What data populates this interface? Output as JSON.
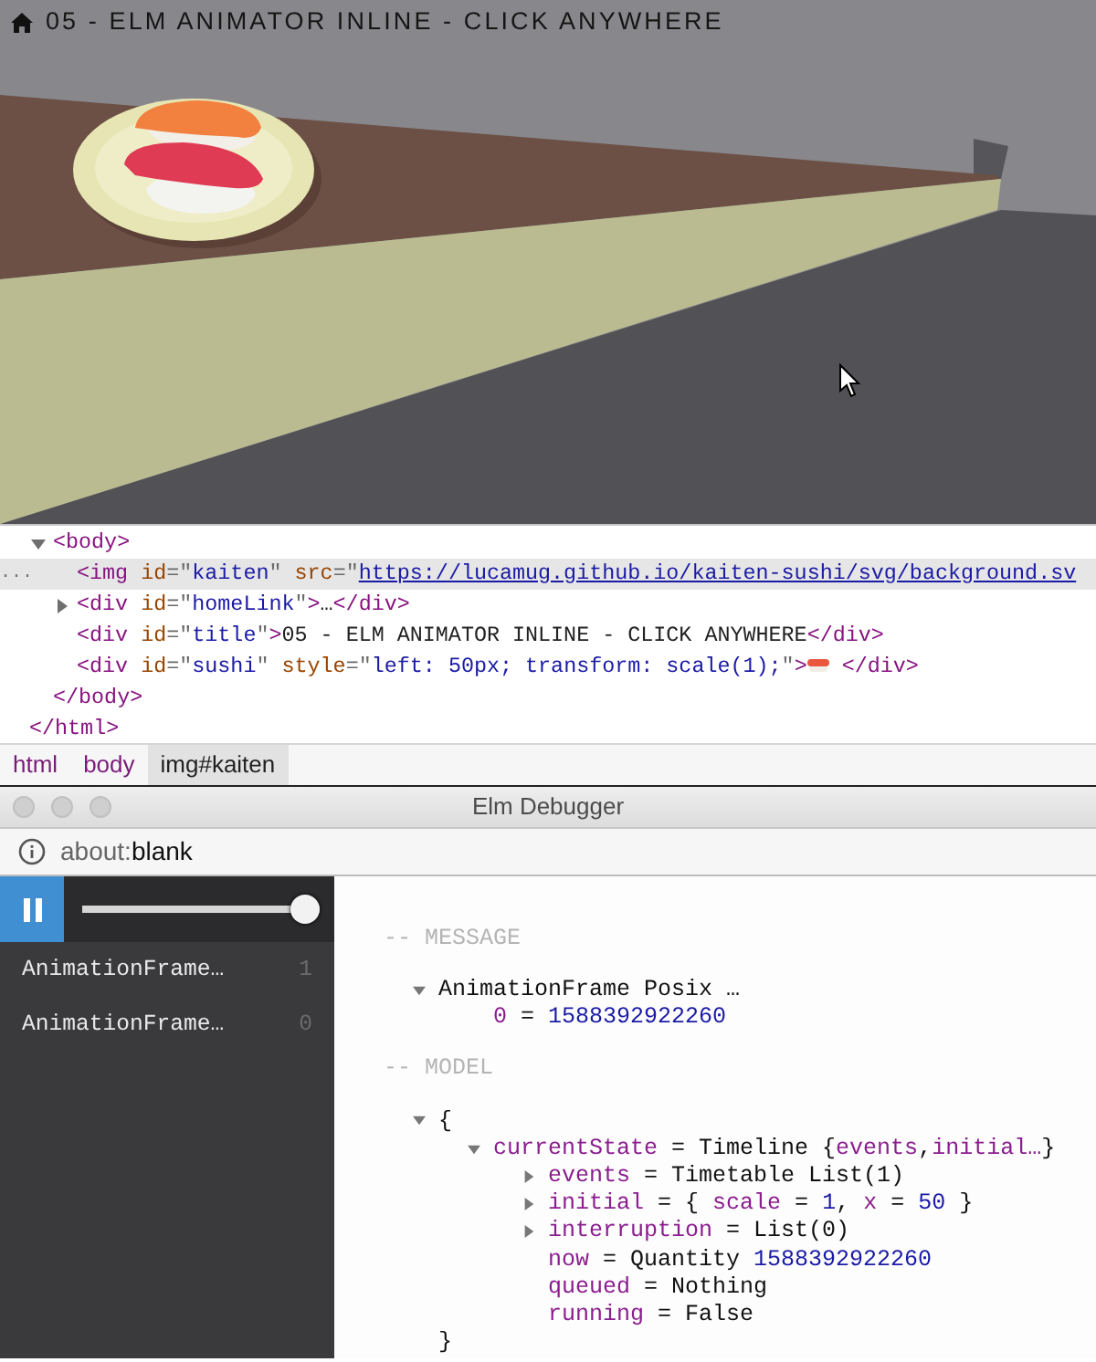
{
  "page_title": {
    "text": "05 - ELM ANIMATOR INLINE - CLICK ANYWHERE"
  },
  "elements_tree": {
    "children": [
      {
        "tokens": [
          {
            "kind": "tag",
            "text": "<body>"
          }
        ],
        "selected": false,
        "expanded": true,
        "close": [
          {
            "kind": "tag",
            "text": "</body>"
          }
        ],
        "children": [
          {
            "gutter": "...",
            "selected": true,
            "tokens": [
              {
                "kind": "tag",
                "text": "<img"
              },
              {
                "kind": "attr",
                "text": " id"
              },
              {
                "kind": "punct",
                "text": "=\""
              },
              {
                "kind": "value",
                "text": "kaiten"
              },
              {
                "kind": "punct",
                "text": "\""
              },
              {
                "kind": "attr",
                "text": " src"
              },
              {
                "kind": "punct",
                "text": "=\""
              },
              {
                "kind": "link",
                "text": "https://lucamug.github.io/kaiten-sushi/svg/background.sv"
              }
            ]
          },
          {
            "selected": false,
            "expanded": false,
            "tokens": [
              {
                "kind": "tag",
                "text": "<div"
              },
              {
                "kind": "attr",
                "text": " id"
              },
              {
                "kind": "punct",
                "text": "=\""
              },
              {
                "kind": "value",
                "text": "homeLink"
              },
              {
                "kind": "punct",
                "text": "\""
              },
              {
                "kind": "tag",
                "text": ">"
              },
              {
                "kind": "text",
                "text": "…"
              },
              {
                "kind": "tag",
                "text": "</div>"
              }
            ]
          },
          {
            "selected": false,
            "tokens": [
              {
                "kind": "tag",
                "text": "<div"
              },
              {
                "kind": "attr",
                "text": " id"
              },
              {
                "kind": "punct",
                "text": "=\""
              },
              {
                "kind": "value",
                "text": "title"
              },
              {
                "kind": "punct",
                "text": "\""
              },
              {
                "kind": "tag",
                "text": ">"
              },
              {
                "kind": "text",
                "text": "05 - ELM ANIMATOR INLINE - CLICK ANYWHERE"
              },
              {
                "kind": "tag",
                "text": "</div>"
              }
            ]
          },
          {
            "selected": false,
            "tokens": [
              {
                "kind": "tag",
                "text": "<div"
              },
              {
                "kind": "attr",
                "text": " id"
              },
              {
                "kind": "punct",
                "text": "=\""
              },
              {
                "kind": "value",
                "text": "sushi"
              },
              {
                "kind": "punct",
                "text": "\""
              },
              {
                "kind": "attr",
                "text": " style"
              },
              {
                "kind": "punct",
                "text": "=\""
              },
              {
                "kind": "value",
                "text": "left: 50px; transform: scale(1);"
              },
              {
                "kind": "punct",
                "text": "\""
              },
              {
                "kind": "tag",
                "text": ">"
              },
              {
                "kind": "emoji"
              },
              {
                "kind": "tag",
                "text": " </div>"
              }
            ]
          }
        ]
      }
    ],
    "close": [
      {
        "kind": "tag",
        "text": "</html>"
      }
    ]
  },
  "breadcrumbs": [
    {
      "label": "html",
      "selected": false
    },
    {
      "label": "body",
      "selected": false
    },
    {
      "label": "img#kaiten",
      "selected": true
    }
  ],
  "debugger": {
    "window_title": "Elm Debugger",
    "address_prefix": "about:",
    "address_rest": "blank",
    "slider": {
      "level": 1
    },
    "history": [
      {
        "label": "AnimationFrame…",
        "index": "1"
      },
      {
        "label": "AnimationFrame…",
        "index": "0"
      }
    ],
    "message_heading": "-- MESSAGE",
    "message": [
      {
        "expanded": true,
        "tokens": [
          {
            "kind": "plain",
            "text": "AnimationFrame Posix …"
          }
        ],
        "children": [
          {
            "tokens": [
              {
                "kind": "key",
                "text": "0"
              },
              {
                "kind": "plain",
                "text": " = "
              },
              {
                "kind": "num",
                "text": "1588392922260"
              }
            ]
          }
        ]
      }
    ],
    "model_heading": "-- MODEL",
    "model": [
      {
        "expanded": true,
        "tokens": [
          {
            "kind": "plain",
            "text": "{"
          }
        ],
        "close": [
          {
            "kind": "plain",
            "text": "}"
          }
        ],
        "children": [
          {
            "expanded": true,
            "tokens": [
              {
                "kind": "key",
                "text": "currentState"
              },
              {
                "kind": "plain",
                "text": " = Timeline {"
              },
              {
                "kind": "key",
                "text": "events"
              },
              {
                "kind": "plain",
                "text": ","
              },
              {
                "kind": "key",
                "text": "initial…"
              },
              {
                "kind": "plain",
                "text": "}"
              }
            ],
            "children": [
              {
                "expanded": false,
                "tokens": [
                  {
                    "kind": "key",
                    "text": "events"
                  },
                  {
                    "kind": "plain",
                    "text": " = Timetable List(1)"
                  }
                ]
              },
              {
                "expanded": false,
                "tokens": [
                  {
                    "kind": "key",
                    "text": "initial"
                  },
                  {
                    "kind": "plain",
                    "text": " = { "
                  },
                  {
                    "kind": "key",
                    "text": "scale"
                  },
                  {
                    "kind": "plain",
                    "text": " = "
                  },
                  {
                    "kind": "num",
                    "text": "1"
                  },
                  {
                    "kind": "plain",
                    "text": ", "
                  },
                  {
                    "kind": "key",
                    "text": "x"
                  },
                  {
                    "kind": "plain",
                    "text": " = "
                  },
                  {
                    "kind": "num",
                    "text": "50"
                  },
                  {
                    "kind": "plain",
                    "text": " }"
                  }
                ]
              },
              {
                "expanded": false,
                "tokens": [
                  {
                    "kind": "key",
                    "text": "interruption"
                  },
                  {
                    "kind": "plain",
                    "text": " = List(0)"
                  }
                ]
              },
              {
                "tokens": [
                  {
                    "kind": "key",
                    "text": "now"
                  },
                  {
                    "kind": "plain",
                    "text": " = Quantity "
                  },
                  {
                    "kind": "num",
                    "text": "1588392922260"
                  }
                ]
              },
              {
                "tokens": [
                  {
                    "kind": "key",
                    "text": "queued"
                  },
                  {
                    "kind": "plain",
                    "text": " = Nothing"
                  }
                ]
              },
              {
                "tokens": [
                  {
                    "kind": "key",
                    "text": "running"
                  },
                  {
                    "kind": "plain",
                    "text": " = False"
                  }
                ]
              }
            ]
          }
        ]
      }
    ]
  }
}
